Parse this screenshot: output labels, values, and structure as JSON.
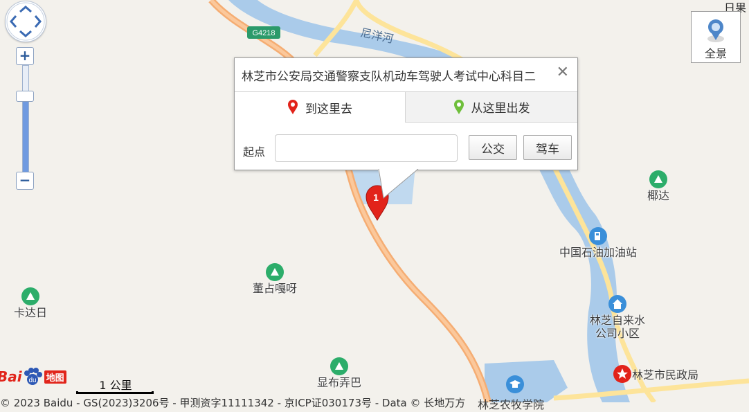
{
  "map": {
    "corner_label": "日果",
    "road_shield": "G4218",
    "river_name": "尼洋河",
    "pois": [
      {
        "name": "椰达",
        "type": "scenic"
      },
      {
        "name": "中国石油加油站",
        "type": "gas"
      },
      {
        "name": "董占嘎呀",
        "type": "scenic"
      },
      {
        "name": "卡达日",
        "type": "scenic"
      },
      {
        "name": "林芝自来水公司小区",
        "type": "residential"
      },
      {
        "name": "显布弄巴",
        "type": "scenic"
      },
      {
        "name": "林芝市民政局",
        "type": "government"
      },
      {
        "name": "林芝农牧学院",
        "type": "school"
      }
    ],
    "marker_number": "1"
  },
  "controls": {
    "zoom_in": "+",
    "zoom_out": "−",
    "zoom_level_fraction": 0.72,
    "panorama_label": "全景"
  },
  "popup": {
    "title": "林芝市公安局交通警察支队机动车驾驶人考试中心科目二",
    "close": "✕",
    "tab_to_here": "到这里去",
    "tab_from_here": "从这里出发",
    "start_label": "起点",
    "start_value": "",
    "bus_button": "公交",
    "drive_button": "驾车"
  },
  "footer": {
    "logo_text": "Bai",
    "logo_map": "地图",
    "scale_label": "1 公里",
    "copyright": "© 2023 Baidu - GS(2023)3206号 - 甲测资字11111342 - 京ICP证030173号 - Data © 长地万方"
  },
  "colors": {
    "water": "#aacbea",
    "highway": "#f5ad73",
    "minor_road": "#fde49a",
    "poi_green": "#2cad6a",
    "poi_blue": "#3a8fd9",
    "marker_red": "#e2231a"
  }
}
